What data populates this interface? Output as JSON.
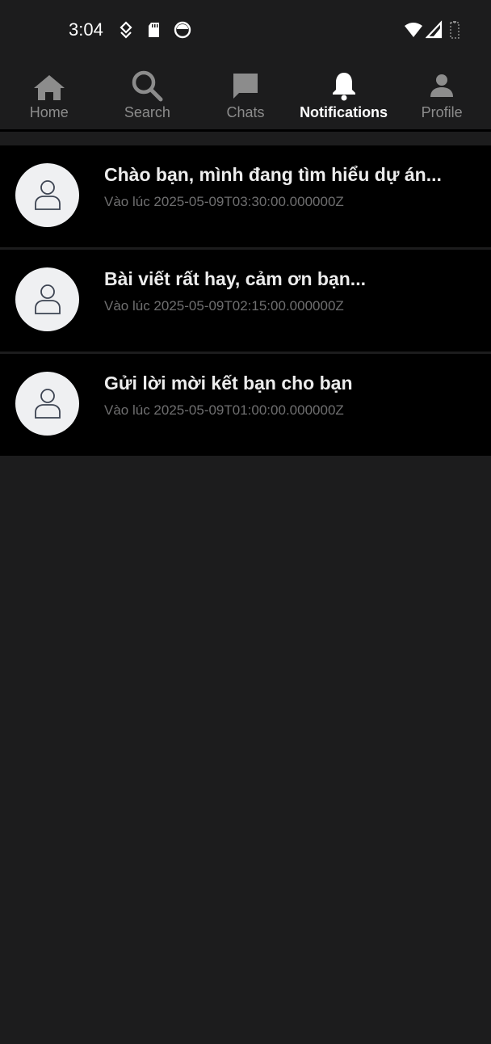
{
  "status_bar": {
    "time": "3:04",
    "left_icons": [
      "location-pin-icon",
      "sd-card-icon",
      "app-circle-icon"
    ],
    "right_icons": [
      "wifi-icon",
      "cellular-signal-icon",
      "battery-icon"
    ]
  },
  "tabs": [
    {
      "label": "Home",
      "icon": "home-icon",
      "active": false
    },
    {
      "label": "Search",
      "icon": "search-icon",
      "active": false
    },
    {
      "label": "Chats",
      "icon": "chat-bubble-icon",
      "active": false
    },
    {
      "label": "Notifications",
      "icon": "bell-icon",
      "active": true
    },
    {
      "label": "Profile",
      "icon": "person-icon",
      "active": false
    }
  ],
  "notifications": [
    {
      "title": "Chào bạn, mình đang tìm hiểu dự án...",
      "time": "Vào lúc 2025-05-09T03:30:00.000000Z",
      "avatar_icon": "user-avatar-icon"
    },
    {
      "title": "Bài viết rất hay, cảm ơn bạn...",
      "time": "Vào lúc 2025-05-09T02:15:00.000000Z",
      "avatar_icon": "user-avatar-icon"
    },
    {
      "title": "Gửi lời mời kết bạn cho bạn",
      "time": "Vào lúc 2025-05-09T01:00:00.000000Z",
      "avatar_icon": "user-avatar-icon"
    }
  ],
  "colors": {
    "background": "#1c1c1d",
    "list_item_bg": "#000000",
    "active_tab": "#ffffff",
    "inactive_tab": "#8c8c8c",
    "title_text": "#ececec",
    "time_text": "#6f6f70",
    "avatar_bg": "#eff0f2"
  }
}
